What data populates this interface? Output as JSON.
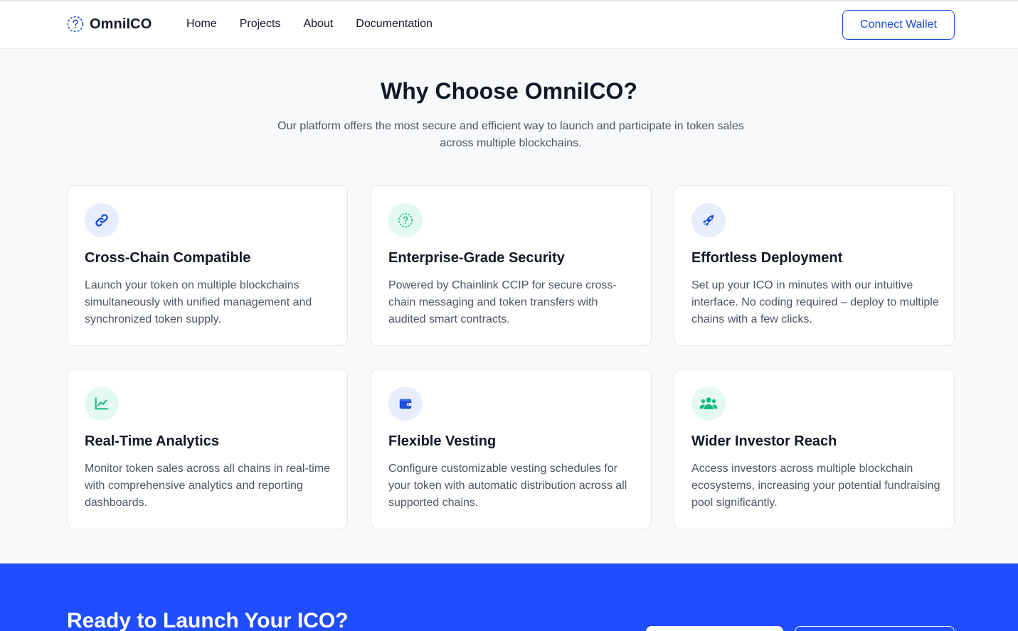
{
  "nav": {
    "logo_text": "OmniICO",
    "links": [
      "Home",
      "Projects",
      "About",
      "Documentation"
    ],
    "connect_label": "Connect Wallet"
  },
  "hero": {
    "title": "Why Choose OmniICO?",
    "subtitle": "Our platform offers the most secure and efficient way to launch and participate in token sales across multiple blockchains."
  },
  "features": [
    {
      "icon": "link-icon",
      "title": "Cross-Chain Compatible",
      "desc": "Launch your token on multiple blockchains simultaneously with unified management and synchronized token supply."
    },
    {
      "icon": "shield-question-icon",
      "title": "Enterprise-Grade Security",
      "desc": "Powered by Chainlink CCIP for secure cross-chain messaging and token transfers with audited smart contracts."
    },
    {
      "icon": "rocket-icon",
      "title": "Effortless Deployment",
      "desc": "Set up your ICO in minutes with our intuitive interface. No coding required – deploy to multiple chains with a few clicks."
    },
    {
      "icon": "chart-line-icon",
      "title": "Real-Time Analytics",
      "desc": "Monitor token sales across all chains in real-time with comprehensive analytics and reporting dashboards."
    },
    {
      "icon": "wallet-icon",
      "title": "Flexible Vesting",
      "desc": "Configure customizable vesting schedules for your token with automatic distribution across all supported chains."
    },
    {
      "icon": "users-icon",
      "title": "Wider Investor Reach",
      "desc": "Access investors across multiple blockchain ecosystems, increasing your potential fundraising pool significantly."
    }
  ],
  "cta": {
    "title": "Ready to Launch Your ICO?"
  },
  "colors": {
    "accent": "#1d4ed8",
    "cta_bg": "#1f4dff",
    "icon_blue": "#1d4ed8",
    "icon_green": "#10b981"
  }
}
